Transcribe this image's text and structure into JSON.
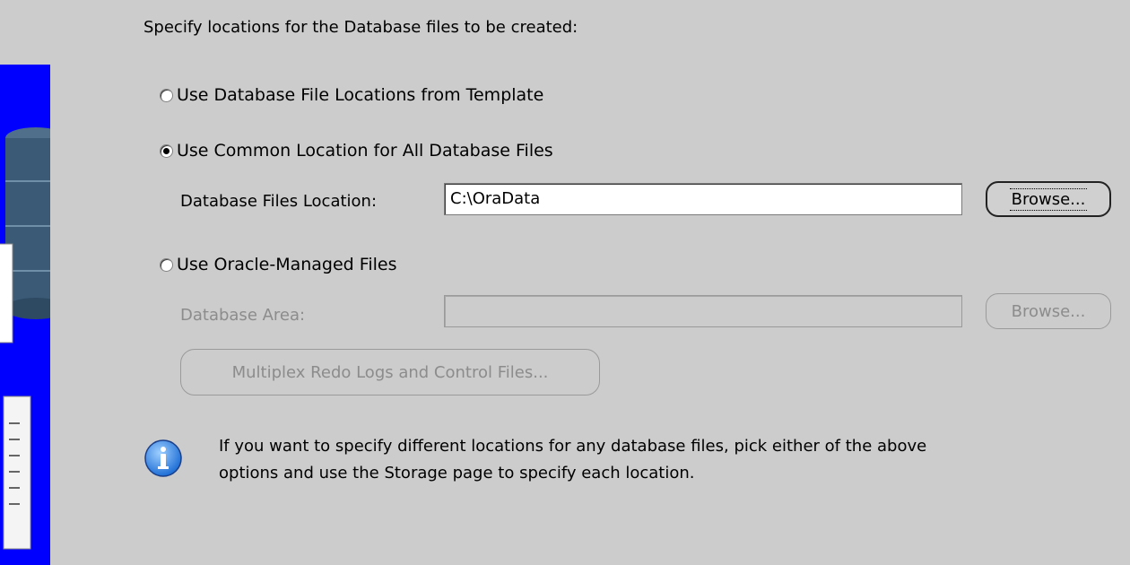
{
  "heading": "Specify locations for the Database files to be created:",
  "options": {
    "template": {
      "label": "Use Database File Locations from Template",
      "checked": false
    },
    "common": {
      "label": "Use Common Location for All Database Files",
      "checked": true
    },
    "managed": {
      "label": "Use Oracle-Managed Files",
      "checked": false
    }
  },
  "common_location": {
    "label": "Database Files Location:",
    "value": "C:\\OraData",
    "browse_label": "Browse..."
  },
  "managed_area": {
    "label": "Database Area:",
    "value": "",
    "browse_label": "Browse..."
  },
  "multiplex_label": "Multiplex Redo Logs and Control Files...",
  "info": {
    "icon": "info-icon",
    "line1": "If you want to specify different locations for any database files, pick either of the above",
    "line2": "options and use the Storage page to specify each location."
  },
  "colors": {
    "background": "#cccccc",
    "banner": "#0000ff"
  }
}
